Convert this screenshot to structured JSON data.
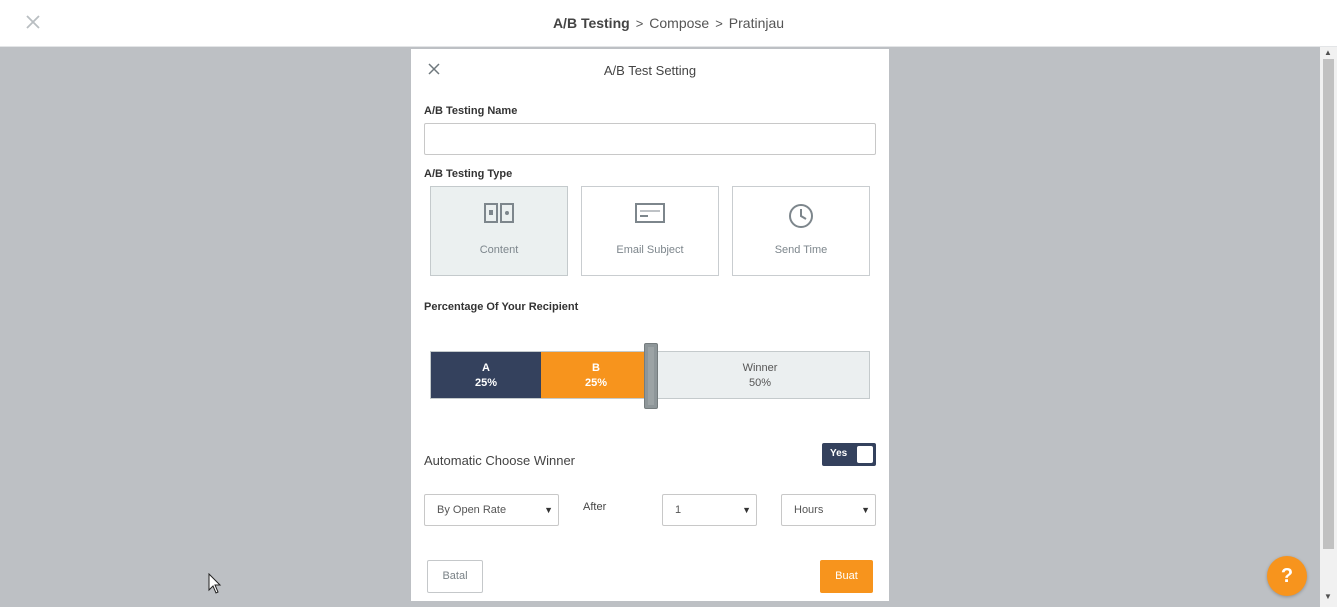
{
  "breadcrumb": {
    "items": [
      "A/B Testing",
      "Compose",
      "Pratinjau"
    ],
    "separator": ">"
  },
  "modal": {
    "title": "A/B Test Setting",
    "name_label": "A/B Testing Name",
    "name_value": "",
    "type_label": "A/B Testing Type",
    "types": [
      {
        "label": "Content",
        "icon": "content-split-icon",
        "selected": true
      },
      {
        "label": "Email Subject",
        "icon": "email-subject-icon",
        "selected": false
      },
      {
        "label": "Send Time",
        "icon": "clock-icon",
        "selected": false
      }
    ],
    "percentage_label": "Percentage Of Your Recipient",
    "segments": {
      "a": {
        "name": "A",
        "percent": "25%",
        "value": 25
      },
      "b": {
        "name": "B",
        "percent": "25%",
        "value": 25
      },
      "winner": {
        "name": "Winner",
        "percent": "50%",
        "value": 50
      }
    },
    "auto_winner_label": "Automatic Choose Winner",
    "toggle_label": "Yes",
    "toggle_on": true,
    "criteria_select": "By Open Rate",
    "after_label": "After",
    "amount_select": "1",
    "unit_select": "Hours",
    "cancel_label": "Batal",
    "create_label": "Buat"
  },
  "help_label": "?",
  "colors": {
    "accent_orange": "#f7941d",
    "navy": "#34415d",
    "backdrop": "#bdc0c4"
  }
}
